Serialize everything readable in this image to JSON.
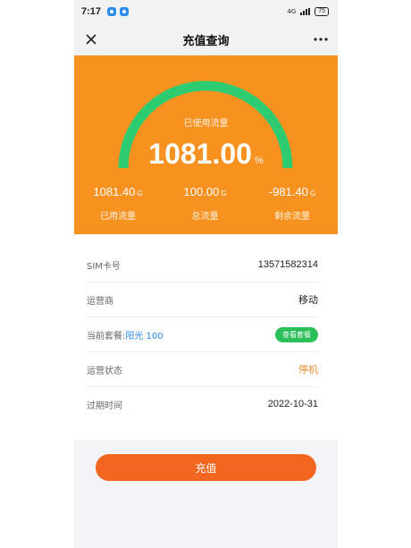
{
  "status_bar": {
    "time": "7:17",
    "network": "4G",
    "battery": "75"
  },
  "nav": {
    "title": "充值查询"
  },
  "usage": {
    "used_label": "已使用流量",
    "used_percent": "1081.00",
    "percent_unit": "%",
    "stats": [
      {
        "value": "1081.40",
        "unit": "G",
        "label": "已用流量"
      },
      {
        "value": "100.00",
        "unit": "G",
        "label": "总流量"
      },
      {
        "value": "-981.40",
        "unit": "G",
        "label": "剩余流量"
      }
    ]
  },
  "info": {
    "sim_label": "SIM卡号",
    "sim_value": "13571582314",
    "carrier_label": "运营商",
    "carrier_value": "移动",
    "plan_label": "当前套餐:",
    "plan_value": "阳光 100",
    "plan_button": "查看套餐",
    "status_label": "运营状态",
    "status_value": "停机",
    "expiry_label": "过期时间",
    "expiry_value": "2022-10-31"
  },
  "actions": {
    "recharge": "充值"
  },
  "colors": {
    "header": "#f7911f",
    "gauge": "#2ecc71",
    "button": "#f3661f",
    "pill": "#2bbf5a"
  },
  "icons": [
    "close-icon",
    "more-icon",
    "signal-icon",
    "battery-icon"
  ]
}
